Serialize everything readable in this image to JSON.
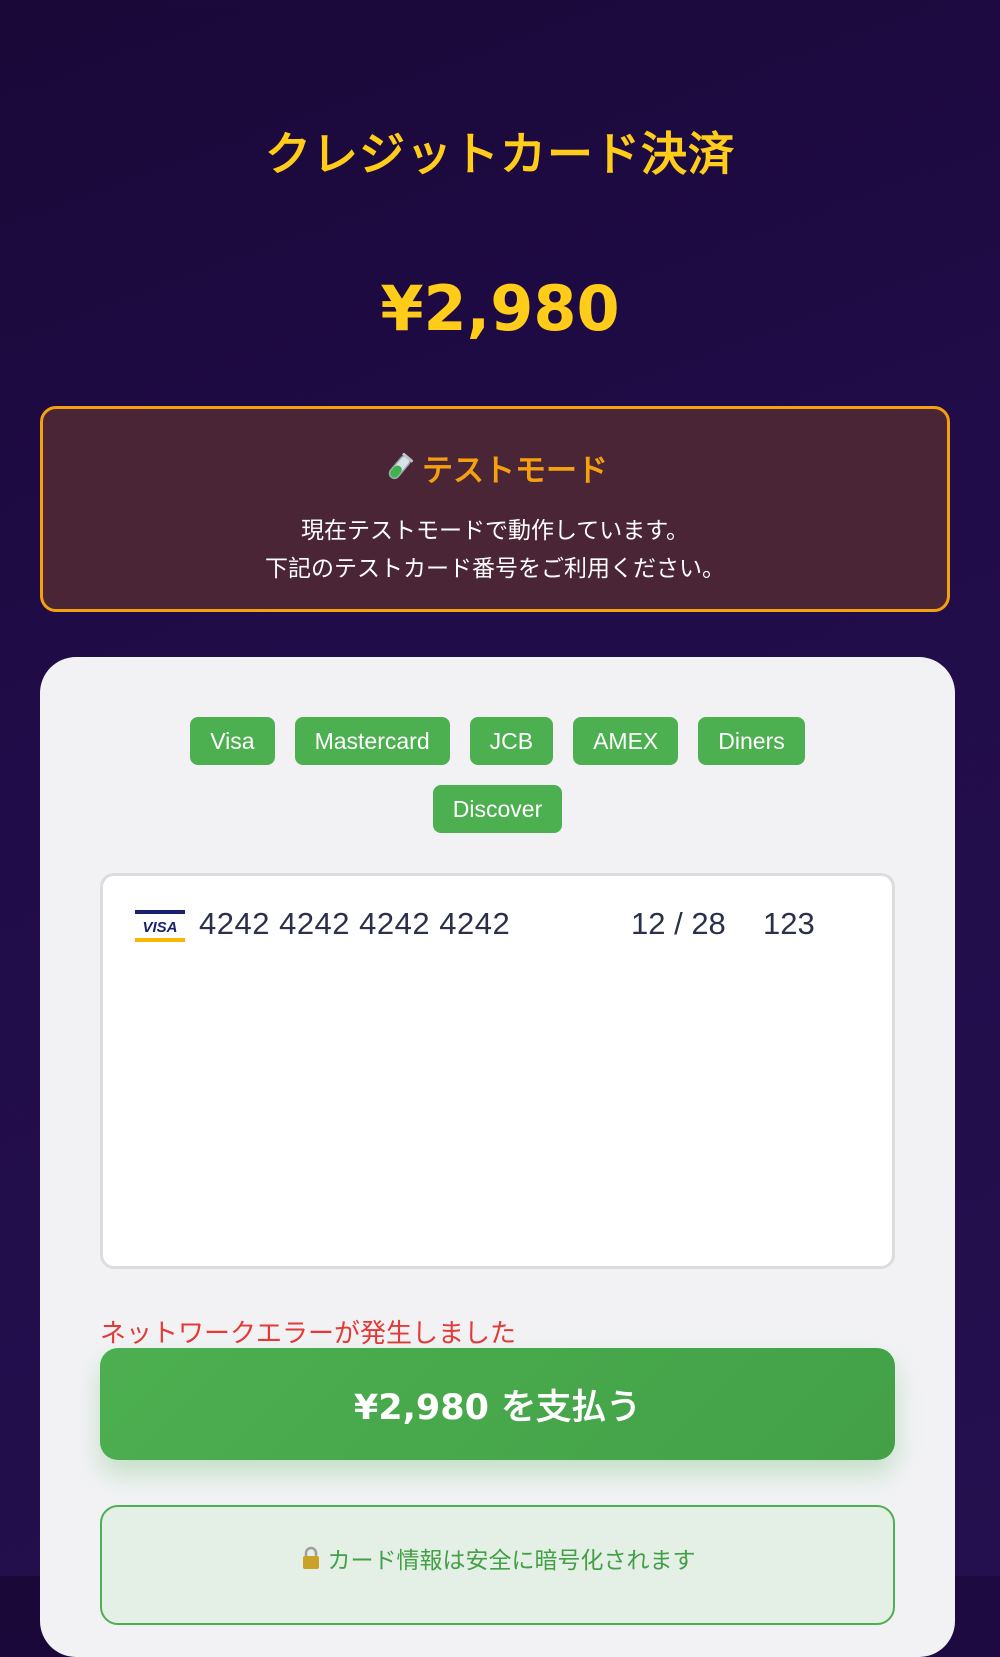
{
  "page": {
    "title": "クレジットカード決済",
    "amount": "¥2,980"
  },
  "test_mode": {
    "icon": "test-tube-icon",
    "title": "テストモード",
    "line1": "現在テストモードで動作しています。",
    "line2": "下記のテストカード番号をご利用ください。"
  },
  "brands": [
    "Visa",
    "Mastercard",
    "JCB",
    "AMEX",
    "Diners",
    "Discover"
  ],
  "card_input": {
    "brand_icon": "visa-icon",
    "number": "4242 4242 4242 4242",
    "expiry": "12 / 28",
    "cvc": "123"
  },
  "error": {
    "message": "ネットワークエラーが発生しました"
  },
  "pay_button": {
    "label": "¥2,980 を支払う"
  },
  "secure": {
    "icon": "lock-icon",
    "text": "カード情報は安全に暗号化されます"
  },
  "colors": {
    "accent_yellow": "#ffcc1a",
    "warning_orange": "#f5a00f",
    "success_green": "#4caf50",
    "error_red": "#e53935"
  }
}
